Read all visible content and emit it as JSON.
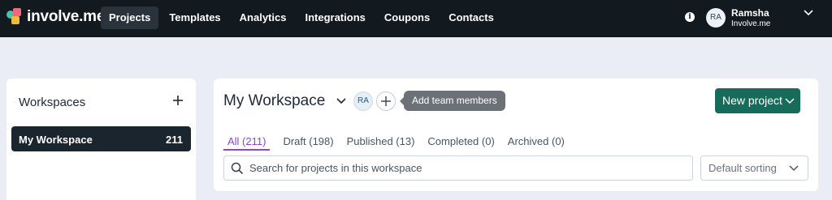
{
  "brand": {
    "name": "involve.me"
  },
  "nav": {
    "items": [
      {
        "label": "Projects",
        "active": true
      },
      {
        "label": "Templates",
        "active": false
      },
      {
        "label": "Analytics",
        "active": false
      },
      {
        "label": "Integrations",
        "active": false
      },
      {
        "label": "Coupons",
        "active": false
      },
      {
        "label": "Contacts",
        "active": false
      }
    ],
    "info_glyph": "i"
  },
  "user": {
    "initials": "RA",
    "name": "Ramsha",
    "org": "Involve.me"
  },
  "sidebar": {
    "title": "Workspaces",
    "items": [
      {
        "label": "My Workspace",
        "count": "211",
        "active": true
      }
    ]
  },
  "workspace": {
    "title": "My Workspace",
    "member_initials": "RA",
    "tooltip": "Add team members",
    "new_project_label": "New project"
  },
  "filters": [
    {
      "label": "All (211)",
      "active": true
    },
    {
      "label": "Draft (198)",
      "active": false
    },
    {
      "label": "Published (13)",
      "active": false
    },
    {
      "label": "Completed (0)",
      "active": false
    },
    {
      "label": "Archived (0)",
      "active": false
    }
  ],
  "search": {
    "placeholder": "Search for projects in this workspace",
    "value": ""
  },
  "sort": {
    "selected": "Default sorting"
  },
  "colors": {
    "topbar": "#12191f",
    "accent_green": "#176b5b",
    "active_filter": "#8a48c9",
    "page_bg": "#eaedf5"
  }
}
